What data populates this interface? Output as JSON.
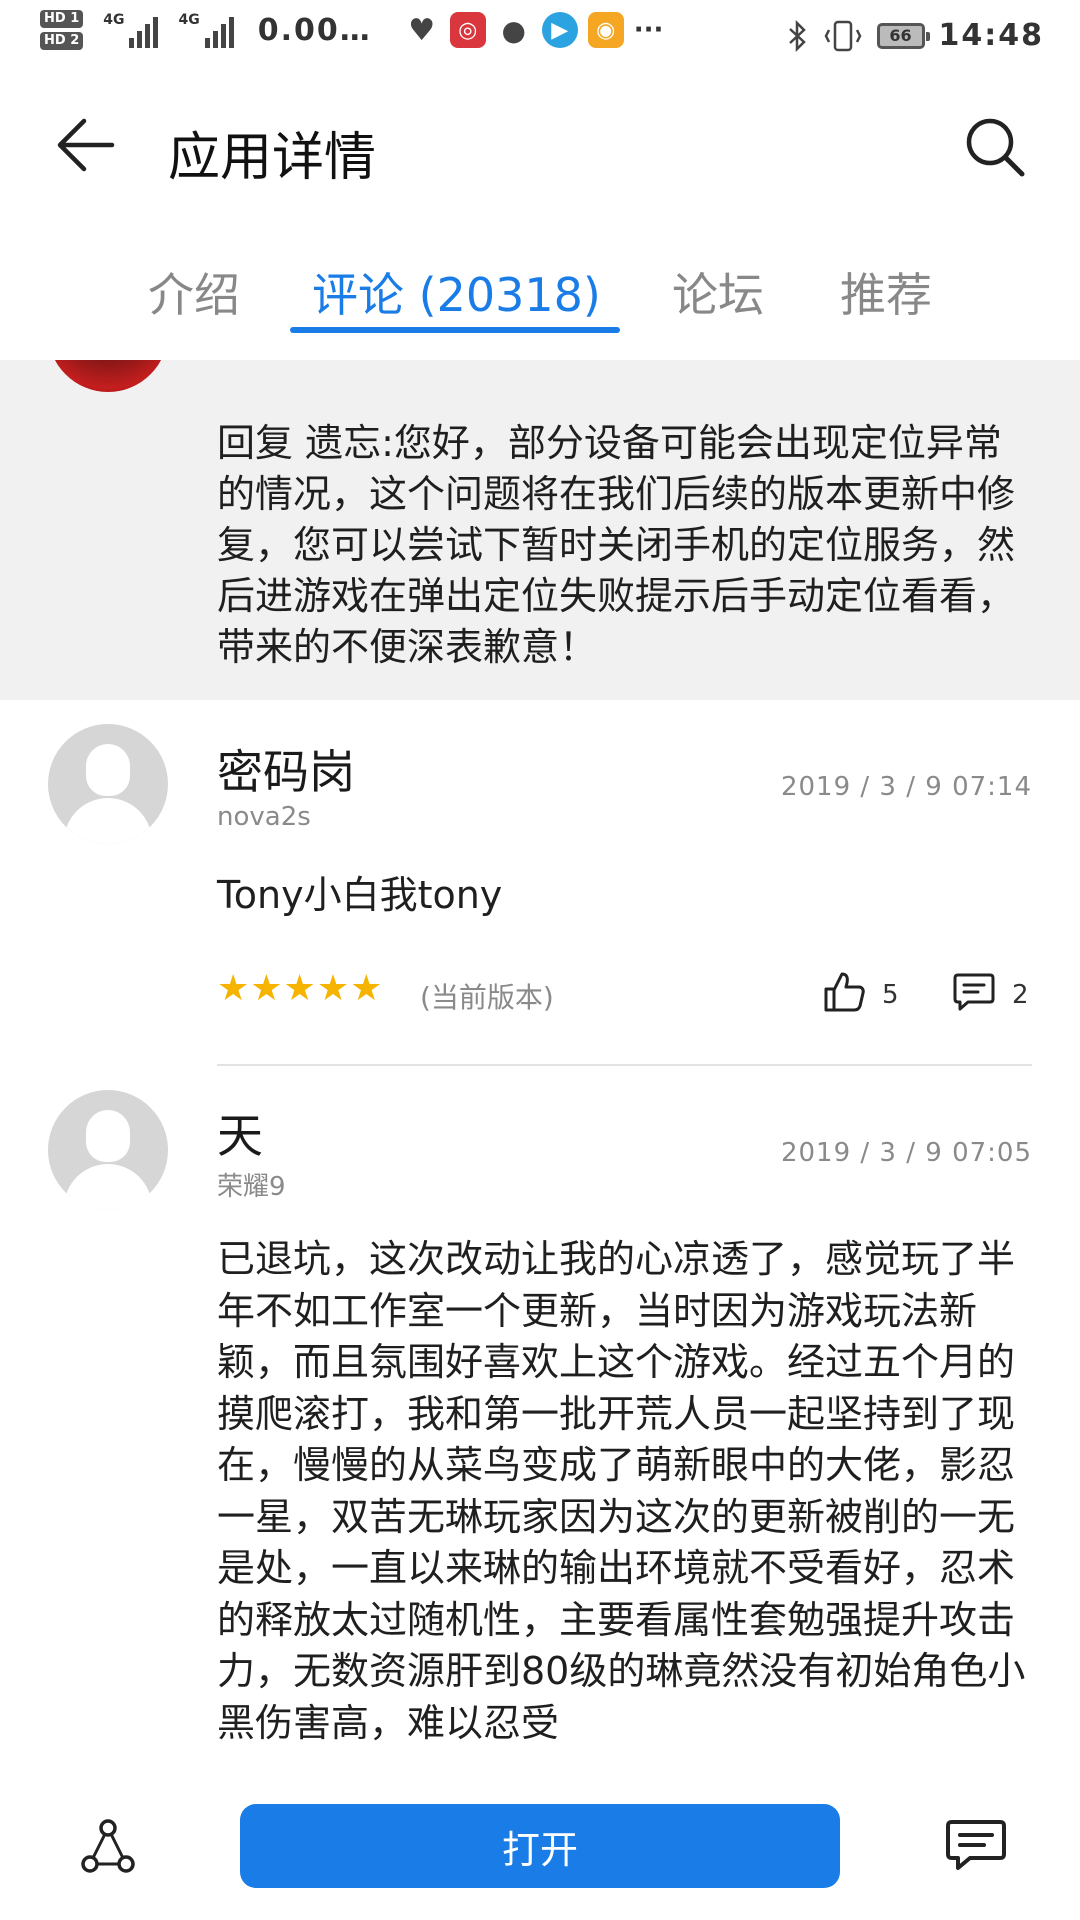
{
  "status_bar": {
    "hd1": "HD 1",
    "hd2": "HD 2",
    "net1": "4G",
    "net2": "4G",
    "speed": "0.00…",
    "more": "···",
    "battery": "66",
    "time": "14:48"
  },
  "header": {
    "title": "应用详情"
  },
  "tabs": [
    {
      "label": "介绍"
    },
    {
      "label": "评论 (20318)"
    },
    {
      "label": "论坛"
    },
    {
      "label": "推荐"
    }
  ],
  "reply": {
    "text": "回复 遗忘:您好，部分设备可能会出现定位异常的情况，这个问题将在我们后续的版本更新中修复，您可以尝试下暂时关闭手机的定位服务，然后进游戏在弹出定位失败提示后手动定位看看，带来的不便深表歉意！"
  },
  "reviews": [
    {
      "username": "密码岗",
      "device": "nova2s",
      "datetime": "2019 / 3 / 9 07:14",
      "content": "Tony小白我tony",
      "rating": 5,
      "stars": "★★★★★",
      "version": "(当前版本)",
      "likes": "5",
      "comments": "2"
    },
    {
      "username": "天",
      "device": "荣耀9",
      "datetime": "2019 / 3 / 9 07:05",
      "content": "已退坑，这次改动让我的心凉透了，感觉玩了半年不如工作室一个更新，当时因为游戏玩法新颖，而且氛围好喜欢上这个游戏。经过五个月的摸爬滚打，我和第一批开荒人员一起坚持到了现在，慢慢的从菜鸟变成了萌新眼中的大佬，影忍一星，双苦无琳玩家因为这次的更新被削的一无是处，一直以来琳的输出环境就不受看好，忍术的释放太过随机性，主要看属性套勉强提升攻击力，无数资源肝到80级的琳竟然没有初始角色小黑伤害高，难以忍受"
    }
  ],
  "bottom_bar": {
    "open_label": "打开"
  },
  "colors": {
    "accent": "#1a7ce6",
    "star": "#f6b400"
  }
}
